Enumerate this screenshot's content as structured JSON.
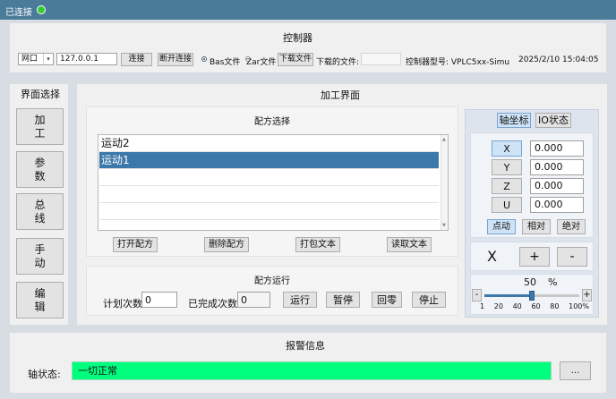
{
  "status": {
    "connection_text": "已连接",
    "indicator_color": "#33cc33"
  },
  "controller": {
    "title": "控制器",
    "port_type": "网口",
    "ip_address": "127.0.0.1",
    "connect_label": "连接",
    "disconnect_label": "断开连接",
    "bas_file_label": "Bas文件",
    "zar_file_label": "Zar文件",
    "download_file_label": "下载文件",
    "downloaded_file_label": "下载的文件:",
    "downloaded_file_value": "",
    "model_label": "控制器型号: VPLC5xx-Simu",
    "datetime": "2025/2/10 15:04:05"
  },
  "sidebar": {
    "title": "界面选择",
    "items": [
      {
        "label": "加工"
      },
      {
        "label": "参数"
      },
      {
        "label": "总线"
      },
      {
        "label": "手动"
      },
      {
        "label": "编辑"
      }
    ]
  },
  "main": {
    "title": "加工界面",
    "recipe_select": {
      "title": "配方选择",
      "items": [
        "运动2",
        "运动1"
      ],
      "selected_index": 1,
      "open_label": "打开配方",
      "delete_label": "删除配方",
      "pack_label": "打包文本",
      "read_label": "读取文本"
    },
    "recipe_run": {
      "title": "配方运行",
      "plan_label": "计划次数",
      "plan_value": "0",
      "done_label": "已完成次数",
      "done_value": "0",
      "run_label": "运行",
      "pause_label": "暂停",
      "home_label": "回零",
      "stop_label": "停止"
    },
    "axis_panel": {
      "tab_coords": "轴坐标",
      "tab_io": "IO状态",
      "axes": [
        {
          "name": "X",
          "value": "0.000"
        },
        {
          "name": "Y",
          "value": "0.000"
        },
        {
          "name": "Z",
          "value": "0.000"
        },
        {
          "name": "U",
          "value": "0.000"
        }
      ],
      "mode_jog": "点动",
      "mode_relative": "相对",
      "mode_absolute": "绝对",
      "current_axis": "X",
      "plus_label": "+",
      "minus_label": "-",
      "speed_value": "50",
      "speed_unit": "%",
      "speed_fraction": 0.5,
      "speed_minus": "-",
      "speed_plus": "+",
      "ticks": [
        "1",
        "20",
        "40",
        "60",
        "80",
        "100%"
      ]
    }
  },
  "alarm": {
    "title": "报警信息",
    "axis_status_label": "轴状态:",
    "axis_status_value": "一切正常",
    "status_color": "#00ff7f",
    "more_label": "..."
  }
}
